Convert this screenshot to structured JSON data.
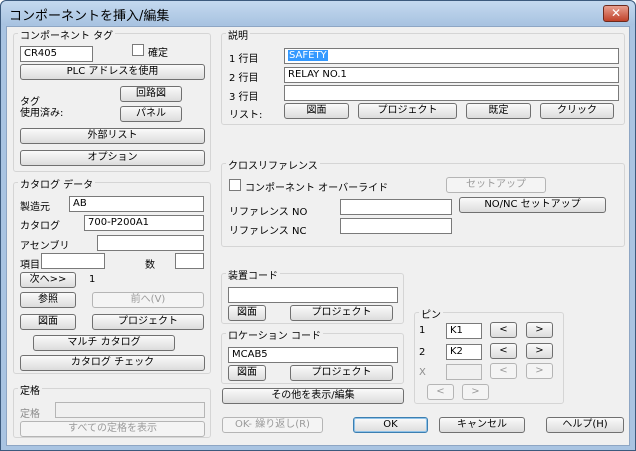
{
  "window": {
    "title": "コンポーネントを挿入/編集",
    "close_glyph": "✕"
  },
  "component_tag": {
    "label": "コンポーネント タグ",
    "tag_value": "CR405",
    "fixed_label": "確定",
    "plc_button": "PLC アドレスを使用",
    "tag_label": "タグ",
    "used_label": "使用済み:",
    "schematic_button": "回路図",
    "panel_button": "パネル",
    "external_list_button": "外部リスト",
    "options_button": "オプション"
  },
  "catalog": {
    "label": "カタログ データ",
    "manufacturer_label": "製造元",
    "manufacturer_value": "AB",
    "catalog_label": "カタログ",
    "catalog_value": "700-P200A1",
    "assembly_label": "アセンブリ",
    "assembly_value": "",
    "item_label": "項目",
    "item_value": "",
    "count_label": "数",
    "count_value": "",
    "next_button": "次へ>>",
    "next_count": "1",
    "lookup_button": "参照",
    "previous_button": "前へ(V)",
    "drawing_button": "図面",
    "project_button": "プロジェクト",
    "multi_catalog_button": "マルチ カタログ",
    "catalog_check_button": "カタログ チェック"
  },
  "rating": {
    "label": "定格",
    "rating_label": "定格",
    "rating_value": "",
    "show_all_button": "すべての定格を表示"
  },
  "description": {
    "label": "説明",
    "line1_label": "1 行目",
    "line1_value": "SAFETY",
    "line2_label": "2 行目",
    "line2_value": "RELAY NO.1",
    "line3_label": "3 行目",
    "line3_value": "",
    "list_label": "リスト:",
    "drawing_button": "図面",
    "project_button": "プロジェクト",
    "defaults_button": "既定",
    "pick_button": "クリック"
  },
  "cross_reference": {
    "label": "クロスリファレンス",
    "override_label": "コンポーネント オーバーライド",
    "setup_button": "セットアップ",
    "ref_no_label": "リファレンス NO",
    "ref_no_value": "",
    "ref_nc_label": "リファレンス NC",
    "ref_nc_value": "",
    "no_nc_setup_button": "NO/NC セットアップ"
  },
  "installation_code": {
    "label": "装置コード",
    "value": "",
    "drawing_button": "図面",
    "project_button": "プロジェクト"
  },
  "location_code": {
    "label": "ロケーション コード",
    "value": "MCAB5",
    "drawing_button": "図面",
    "project_button": "プロジェクト"
  },
  "pins": {
    "label": "ピン",
    "pin1_label": "1",
    "pin1_value": "K1",
    "pin2_label": "2",
    "pin2_value": "K2",
    "pinx_label": "X",
    "pinx_value": "",
    "prev_glyph": "<",
    "next_glyph": ">"
  },
  "footer": {
    "show_edit_others_button": "その他を表示/編集",
    "ok_repeat_button": "OK- 繰り返し(R)",
    "ok_button": "OK",
    "cancel_button": "キャンセル",
    "help_button": "ヘルプ(H)"
  }
}
